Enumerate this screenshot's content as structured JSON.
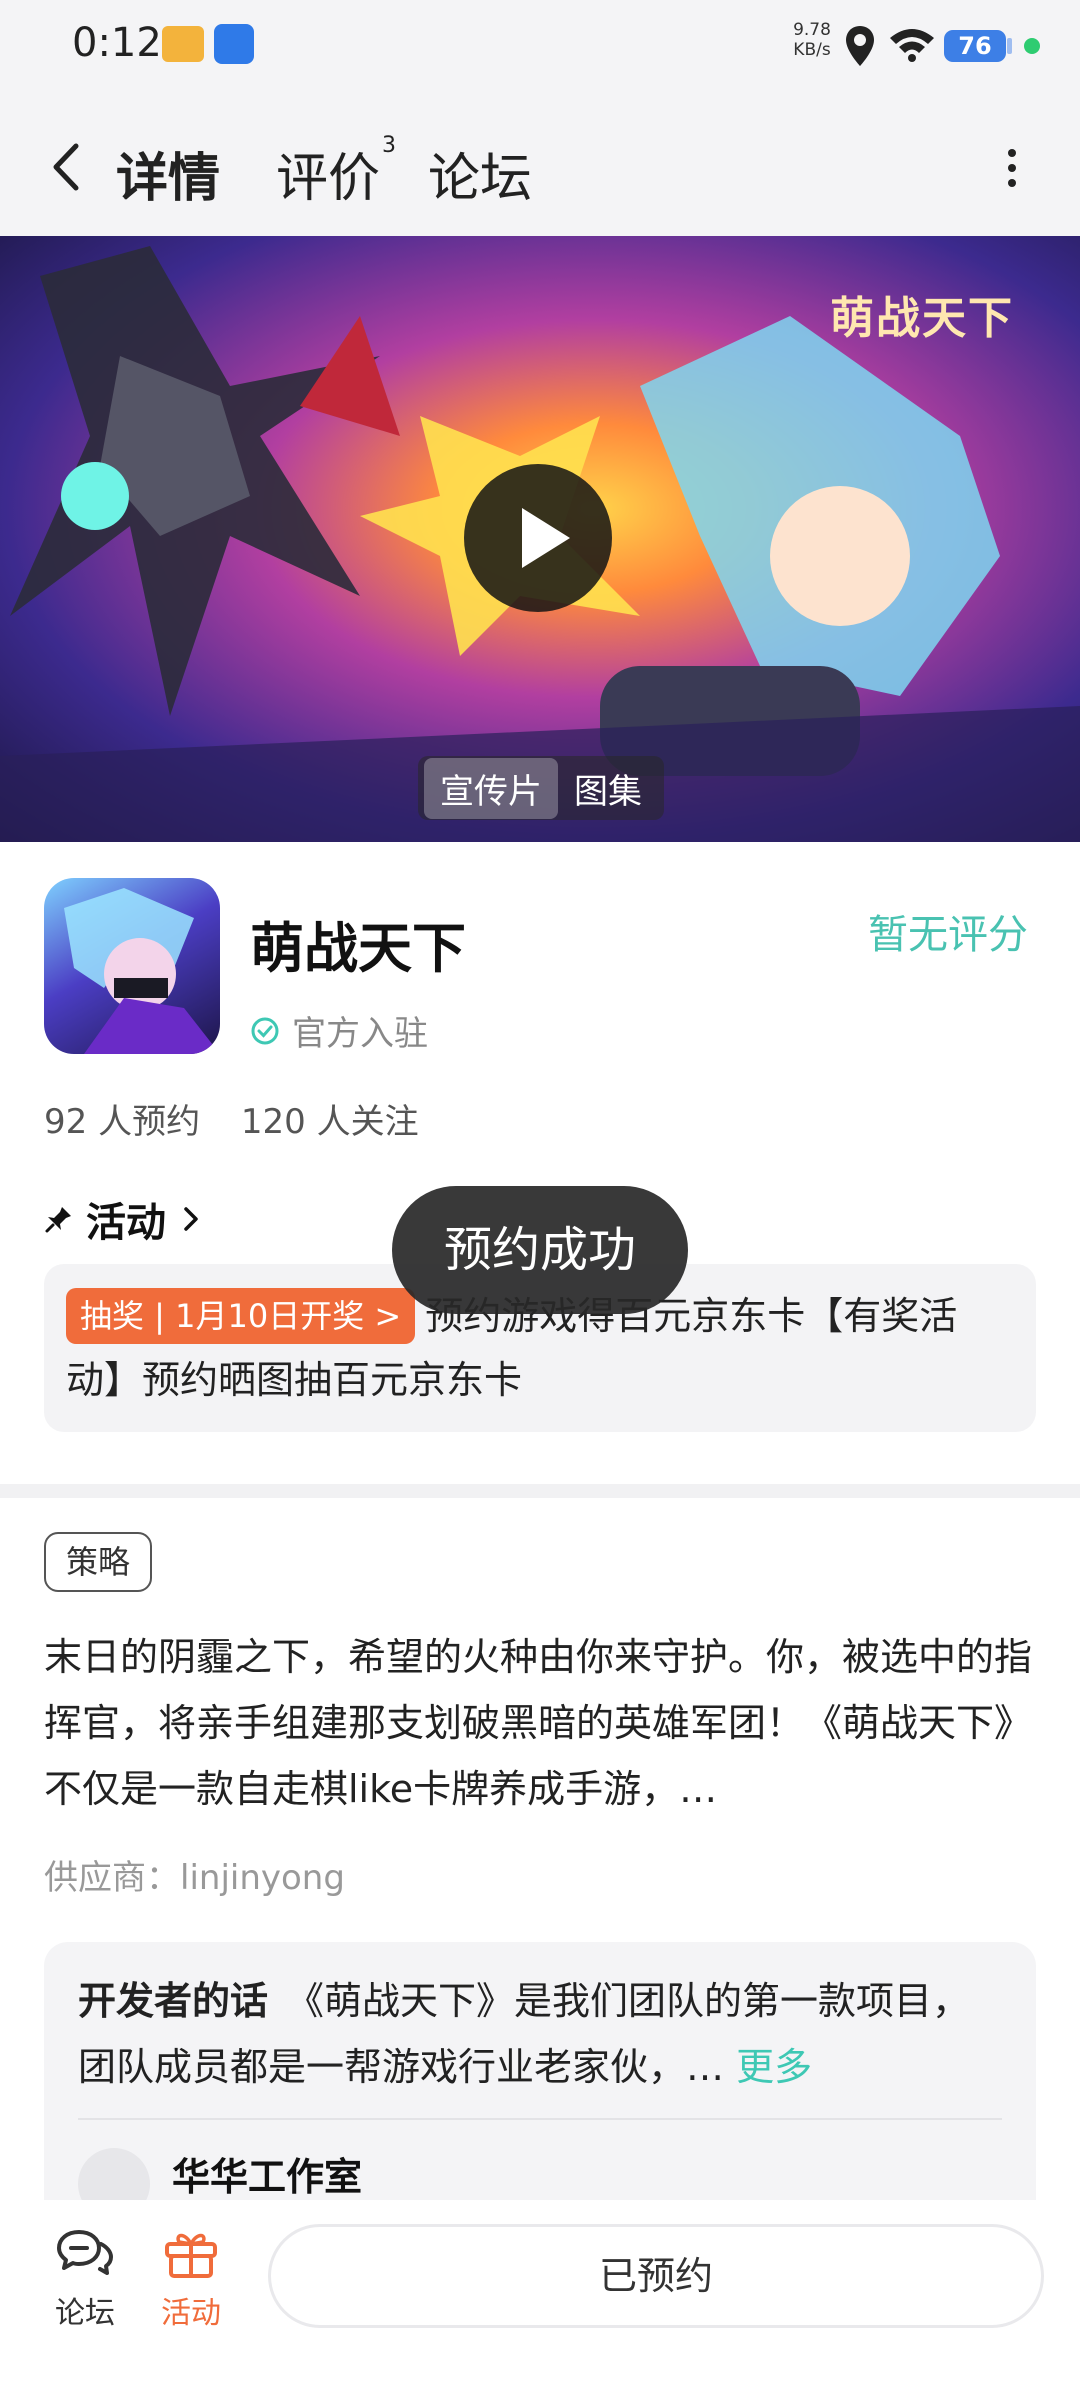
{
  "status_bar": {
    "time": "0:12",
    "net_speed_value": "9.78",
    "net_speed_unit": "KB/s",
    "battery": "76",
    "icons": [
      "app-notification-icon",
      "app-notification-icon-2",
      "location-icon",
      "wifi-icon",
      "battery-icon"
    ]
  },
  "header": {
    "tabs": [
      {
        "label": "详情",
        "active": true
      },
      {
        "label": "评价",
        "badge": "3"
      },
      {
        "label": "论坛"
      }
    ]
  },
  "banner": {
    "logo_text": "萌战天下",
    "tabs": [
      "宣传片",
      "图集"
    ],
    "active_tab": "宣传片"
  },
  "app": {
    "name": "萌战天下",
    "rating_text": "暂无评分",
    "official_text": "官方入驻",
    "reservations": "92 人预约",
    "followers": "120 人关注"
  },
  "activity": {
    "heading": "活动",
    "tag": "抽奖 | 1月10日开奖 >",
    "text": "预约游戏得百元京东卡【有奖活动】预约晒图抽百元京东卡"
  },
  "description": {
    "tag": "策略",
    "text": "末日的阴霾之下，希望的火种由你来守护。你，被选中的指挥官，将亲手组建那支划破黑暗的英雄军团！《萌战天下》不仅是一款自走棋like卡牌养成手游，…",
    "supplier": "供应商：linjinyong"
  },
  "developer": {
    "label": "开发者的话",
    "text": "《萌战天下》是我们团队的第一款项目，团队成员都是一帮游戏行业老家伙，…",
    "more": "更多",
    "studio": "华华工作室"
  },
  "bottom_bar": {
    "forum_label": "论坛",
    "activity_label": "活动",
    "reserved_label": "已预约"
  },
  "toast": "预约成功",
  "colors": {
    "accent": "#3ec8b4",
    "orange": "#f06c3b"
  }
}
